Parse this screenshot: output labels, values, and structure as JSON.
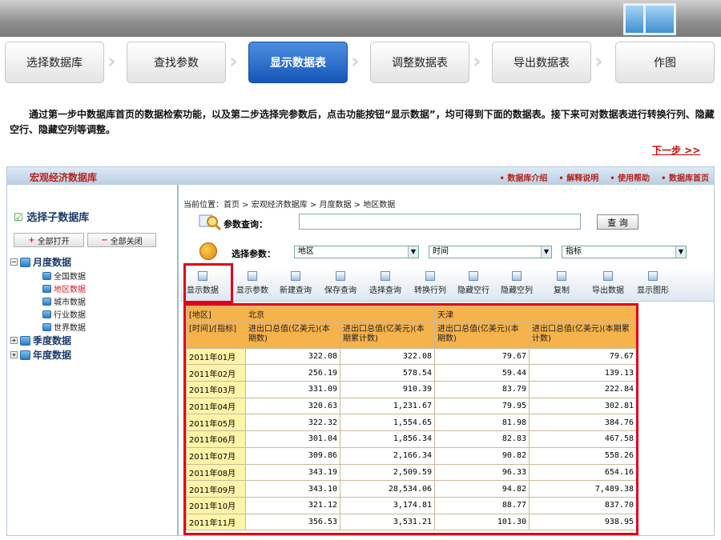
{
  "steps": [
    {
      "label": "选择数据库"
    },
    {
      "label": "查找参数"
    },
    {
      "label": "显示数据表"
    },
    {
      "label": "调整数据表"
    },
    {
      "label": "导出数据表"
    },
    {
      "label": "作图"
    }
  ],
  "active_step_color": "#1656b8",
  "intro": "通过第一步中数据库首页的数据检索功能，以及第二步选择完参数后，点击功能按钮“显示数据”，均可得到下面的数据表。接下来可对数据表进行转换行列、隐藏空行、隐藏空列等调整。",
  "next_link": "下一步 >>",
  "panel": {
    "brand": "宏观经济数据库",
    "header_links": [
      "• 数据库介绍",
      "• 解释说明",
      "• 使用帮助",
      "• 数据库首页"
    ]
  },
  "sidebar": {
    "title": "选择子数据库",
    "expand_all": "全部打开",
    "collapse_all": "全部关闭",
    "tree": [
      {
        "label": "月度数据",
        "children": [
          "全国数据",
          "地区数据",
          "城市数据",
          "行业数据",
          "世界数据"
        ],
        "selected_child": "地区数据"
      },
      {
        "label": "季度数据"
      },
      {
        "label": "年度数据"
      }
    ]
  },
  "main": {
    "breadcrumb": "当前位置：首页 > 宏观经济数据库 > 月度数据 > 地区数据",
    "query_label": "参数查询：",
    "query_value": "",
    "query_button": "查 询",
    "param_label": "选择参数：",
    "param_selects": [
      "地区",
      "时间",
      "指标"
    ],
    "toolbar": [
      "显示数据",
      "显示参数",
      "新建查询",
      "保存查询",
      "选择查询",
      "转换行列",
      "隐藏空行",
      "隐藏空列",
      "复制",
      "导出数据",
      "显示图形"
    ],
    "table": {
      "corner_region": "[地区]",
      "corner_time": "[时间]/[指标]",
      "regions": [
        "北京",
        "天津"
      ],
      "indicators": [
        "进出口总值(亿美元)(本期数)",
        "进出口总值(亿美元)(本期累计数)",
        "进出口总值(亿美元)(本期数)",
        "进出口总值(亿美元)(本期累计数)"
      ],
      "rows": [
        {
          "date": "2011年01月",
          "v": [
            "322.08",
            "322.08",
            "79.67",
            "79.67"
          ]
        },
        {
          "date": "2011年02月",
          "v": [
            "256.19",
            "578.54",
            "59.44",
            "139.13"
          ]
        },
        {
          "date": "2011年03月",
          "v": [
            "331.09",
            "910.39",
            "83.79",
            "222.84"
          ]
        },
        {
          "date": "2011年04月",
          "v": [
            "320.63",
            "1,231.67",
            "79.95",
            "302.81"
          ]
        },
        {
          "date": "2011年05月",
          "v": [
            "322.32",
            "1,554.65",
            "81.98",
            "384.76"
          ]
        },
        {
          "date": "2011年06月",
          "v": [
            "301.04",
            "1,856.34",
            "82.83",
            "467.58"
          ]
        },
        {
          "date": "2011年07月",
          "v": [
            "309.86",
            "2,166.34",
            "90.82",
            "558.26"
          ]
        },
        {
          "date": "2011年08月",
          "v": [
            "343.19",
            "2,509.59",
            "96.33",
            "654.16"
          ]
        },
        {
          "date": "2011年09月",
          "v": [
            "343.10",
            "28,534.06",
            "94.82",
            "7,489.38"
          ]
        },
        {
          "date": "2011年10月",
          "v": [
            "321.12",
            "3,174.81",
            "88.77",
            "837.70"
          ]
        },
        {
          "date": "2011年11月",
          "v": [
            "356.53",
            "3,531.21",
            "101.30",
            "938.95"
          ]
        }
      ]
    }
  }
}
